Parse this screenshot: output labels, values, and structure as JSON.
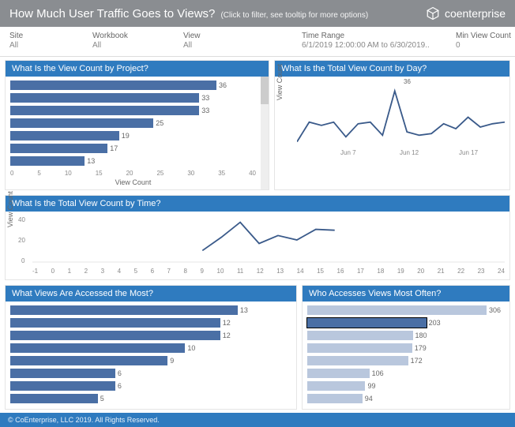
{
  "header": {
    "title": "How Much User Traffic Goes to Views?",
    "subtitle": "(Click to filter, see tooltip for more options)",
    "brand": "coenterprise"
  },
  "filters": [
    {
      "label": "Site",
      "value": "All"
    },
    {
      "label": "Workbook",
      "value": "All"
    },
    {
      "label": "View",
      "value": "All"
    },
    {
      "label": "Time Range",
      "value": "6/1/2019 12:00:00 AM to 6/30/2019.."
    },
    {
      "label": "Min View Count",
      "value": "0"
    }
  ],
  "panels": {
    "byProject": {
      "title": "What Is the View Count by Project?",
      "xlabel": "View Count"
    },
    "byDay": {
      "title": "What Is the Total View Count by Day?",
      "ylabel": "View Count",
      "peak": "36"
    },
    "byTime": {
      "title": "What Is the Total View Count by Time?",
      "ylabel": "View Count"
    },
    "mostViews": {
      "title": "What Views Are Accessed the Most?"
    },
    "whoAccesses": {
      "title": "Who Accesses Views Most Often?"
    }
  },
  "footer": "© CoEnterprise, LLC 2019. All Rights Reserved.",
  "chart_data": [
    {
      "type": "bar",
      "orientation": "horizontal",
      "title": "What Is the View Count by Project?",
      "values": [
        36,
        33,
        33,
        25,
        19,
        17,
        13
      ],
      "xlabel": "View Count",
      "xlim": [
        0,
        40
      ],
      "xticks": [
        0,
        5,
        10,
        15,
        20,
        25,
        30,
        35,
        40
      ]
    },
    {
      "type": "line",
      "title": "What Is the Total View Count by Day?",
      "x": [
        "Jun 3",
        "Jun 4",
        "Jun 5",
        "Jun 6",
        "Jun 7",
        "Jun 8",
        "Jun 9",
        "Jun 10",
        "Jun 11",
        "Jun 12",
        "Jun 13",
        "Jun 14",
        "Jun 15",
        "Jun 16",
        "Jun 17",
        "Jun 18",
        "Jun 19",
        "Jun 20"
      ],
      "values": [
        5,
        17,
        15,
        17,
        8,
        16,
        17,
        9,
        36,
        11,
        9,
        10,
        16,
        13,
        20,
        14,
        16,
        17
      ],
      "ylabel": "View Count",
      "xticks_shown": [
        "Jun 7",
        "Jun 12",
        "Jun 17"
      ],
      "annotations": [
        {
          "x": "Jun 12",
          "y": 36,
          "text": "36"
        }
      ]
    },
    {
      "type": "line",
      "title": "What Is the Total View Count by Time?",
      "x": [
        8,
        9,
        10,
        11,
        12,
        13,
        14,
        15
      ],
      "values": [
        13,
        28,
        45,
        21,
        30,
        25,
        37,
        36
      ],
      "ylabel": "View Count",
      "xlim": [
        -1,
        24
      ],
      "xticks": [
        -1,
        0,
        1,
        2,
        3,
        4,
        5,
        6,
        7,
        8,
        9,
        10,
        11,
        12,
        13,
        14,
        15,
        16,
        17,
        18,
        19,
        20,
        21,
        22,
        23,
        24
      ],
      "yticks": [
        0,
        20,
        40
      ]
    },
    {
      "type": "bar",
      "orientation": "horizontal",
      "title": "What Views Are Accessed the Most?",
      "values": [
        13,
        12,
        12,
        10,
        9,
        6,
        6,
        5
      ]
    },
    {
      "type": "bar",
      "orientation": "horizontal",
      "title": "Who Accesses Views Most Often?",
      "values": [
        306,
        203,
        180,
        179,
        172,
        106,
        99,
        94
      ],
      "selected_index": 1
    }
  ]
}
